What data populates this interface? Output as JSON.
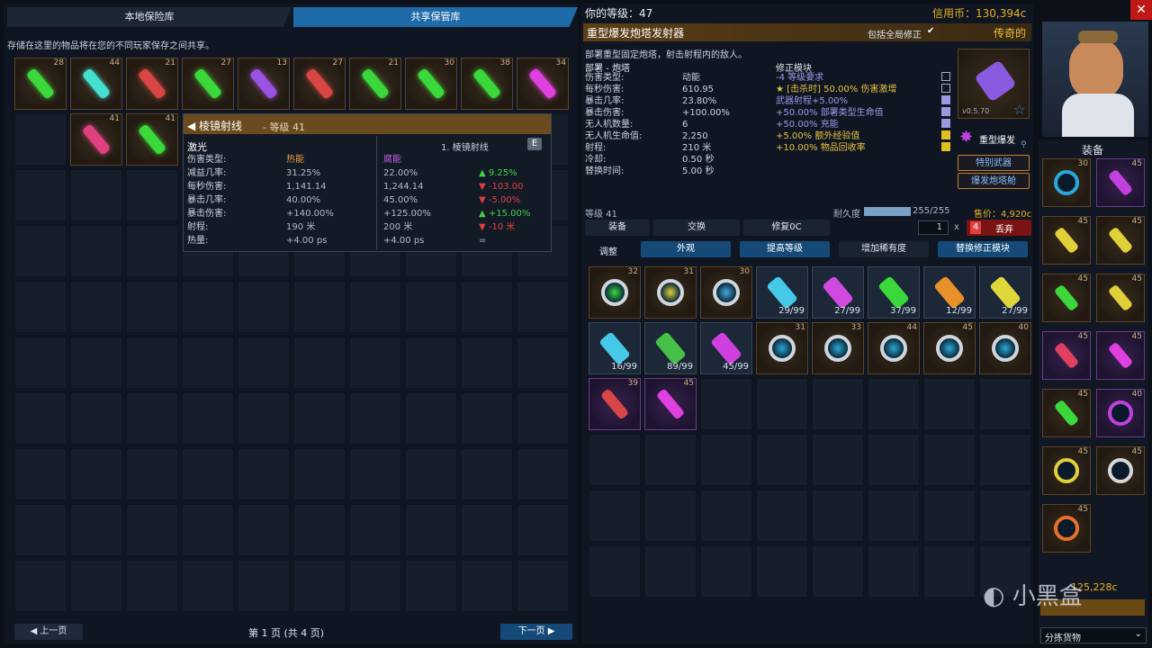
{
  "tabs": {
    "local": "本地保险库",
    "shared": "共享保管库"
  },
  "vault": {
    "description": "存储在这里的物品将在您的不同玩家保存之间共享。",
    "items_row1": [
      {
        "level": "28",
        "color": "#3ad83a"
      },
      {
        "level": "44",
        "color": "#46e0d0"
      },
      {
        "level": "21",
        "color": "#d84646"
      },
      {
        "level": "27",
        "color": "#3ad83a"
      },
      {
        "level": "13",
        "color": "#9a52e0"
      },
      {
        "level": "27",
        "color": "#d84646"
      },
      {
        "level": "21",
        "color": "#3ad83a"
      },
      {
        "level": "30",
        "color": "#3ad83a"
      },
      {
        "level": "38",
        "color": "#3ad83a"
      },
      {
        "level": "34",
        "color": "#e040e0"
      }
    ],
    "items_row2": [
      {
        "level": "41",
        "color": "#e04080"
      },
      {
        "level": "41",
        "color": "#3ad83a"
      }
    ],
    "page_label": "第 1 页 (共 4 页)",
    "prev_label": "◀ 上一页",
    "next_label": "下一页 ▶"
  },
  "tooltip": {
    "title": "◀ 棱镜射线",
    "level": "- 等级 41",
    "name": "激光",
    "compare_name": "1. 棱镜射线",
    "key": "E",
    "col_head_a": "热能",
    "col_head_b": "腐能",
    "rows": [
      {
        "label": "伤害类型:",
        "a": "热能",
        "b": "腐能",
        "d": ""
      },
      {
        "label": "减益几率:",
        "a": "31.25%",
        "b": "22.00%",
        "d": "▲ 9.25%"
      },
      {
        "label": "每秒伤害:",
        "a": "1,141.14",
        "b": "1,244.14",
        "d": "▼ -103.00"
      },
      {
        "label": "暴击几率:",
        "a": "40.00%",
        "b": "45.00%",
        "d": "▼ -5.00%"
      },
      {
        "label": "暴击伤害:",
        "a": "+140.00%",
        "b": "+125.00%",
        "d": "▲ +15.00%"
      },
      {
        "label": "射程:",
        "a": "190 米",
        "b": "200 米",
        "d": "▼ -10 米"
      },
      {
        "label": "热量:",
        "a": "+4.00 ps",
        "b": "+4.00 ps",
        "d": "="
      }
    ]
  },
  "header": {
    "player_level": "你的等级：47",
    "credits": "信用币：130,394c"
  },
  "item": {
    "name": "重型爆发炮塔发射器",
    "include_global": "包括全局修正",
    "rarity": "传奇的",
    "desc": "部署重型固定炮塔，射击射程内的敌人。",
    "section_a": "部署 - 炮塔",
    "section_b": "修正模块",
    "stats": [
      {
        "label": "伤害类型:",
        "value": "动能",
        "mod": "-4 等级要求"
      },
      {
        "label": "每秒伤害:",
        "value": "610.95",
        "mod": "★ [击杀时] 50.00% 伤害激增"
      },
      {
        "label": "暴击几率:",
        "value": "23.80%",
        "mod": "武器射程+5.00%"
      },
      {
        "label": "暴击伤害:",
        "value": "+100.00%",
        "mod": "+50.00% 部署类型生命值"
      },
      {
        "label": "无人机数量:",
        "value": "6",
        "mod": "+50.00% 充能"
      },
      {
        "label": "无人机生命值:",
        "value": "2,250",
        "mod": "+5.00% 额外经验值"
      },
      {
        "label": "射程:",
        "value": "210 米",
        "mod": "+10.00% 物品回收率"
      },
      {
        "label": "冷却:",
        "value": "0.50 秒",
        "mod": ""
      },
      {
        "label": "替换时间:",
        "value": "5.00 秒",
        "mod": ""
      }
    ],
    "version": "v0.5.70",
    "mod_name": "重型爆发",
    "tag1": "特别武器",
    "tag2": "爆发炮塔舱",
    "level": "等级 41",
    "durability_label": "耐久度",
    "durability_value": "255/255",
    "durability_fraction": 1.0,
    "sell": "售价：4,920c"
  },
  "actions": {
    "equip": "装备",
    "swap": "交换",
    "repair": "修复0C",
    "qty": "1",
    "x": "x",
    "drop_key": "4",
    "drop": "丢弃",
    "adjust": "调整",
    "look": "外观",
    "upgrade": "提高等级",
    "rarity": "增加稀有度",
    "replace_mod": "替换修正模块"
  },
  "inventory": [
    {
      "label": "32",
      "kind": "circle",
      "color": "#3ad83a"
    },
    {
      "label": "31",
      "kind": "circle",
      "color": "#e0d03a"
    },
    {
      "label": "30",
      "kind": "circle",
      "color": "#46a8e0"
    },
    {
      "label": "29/99",
      "kind": "pill",
      "color": "#46c8e8"
    },
    {
      "label": "27/99",
      "kind": "pill",
      "color": "#d04ae0"
    },
    {
      "label": "37/99",
      "kind": "pill",
      "color": "#3ad83a"
    },
    {
      "label": "12/99",
      "kind": "pill",
      "color": "#e8902a"
    },
    {
      "label": "27/99",
      "kind": "pill",
      "color": "#e0d83a"
    },
    {
      "label": "16/99",
      "kind": "pill",
      "color": "#46c8e8"
    },
    {
      "label": "89/99",
      "kind": "pill",
      "color": "#46c046"
    },
    {
      "label": "45/99",
      "kind": "pill",
      "color": "#d040e0"
    },
    {
      "label": "31",
      "kind": "circle",
      "color": "#2aa8d8"
    },
    {
      "label": "33",
      "kind": "circle",
      "color": "#2aa8d8"
    },
    {
      "label": "44",
      "kind": "circle",
      "color": "#2aa8d8"
    },
    {
      "label": "45",
      "kind": "circle",
      "color": "#2aa8d8"
    },
    {
      "label": "40",
      "kind": "circle",
      "color": "#2aa8d8"
    },
    {
      "label": "39",
      "kind": "purple",
      "color": "#d84646"
    },
    {
      "label": "45",
      "kind": "purple",
      "color": "#e040e0"
    }
  ],
  "equipment": {
    "title": "装备",
    "slots": [
      {
        "level": "30",
        "color": "#2aa8d8"
      },
      {
        "level": "45",
        "color": "#c040e0"
      },
      {
        "level": "45",
        "color": "#e0d03a"
      },
      {
        "level": "45",
        "color": "#e0d03a"
      },
      {
        "level": "45",
        "color": "#3ad83a"
      },
      {
        "level": "45",
        "color": "#e0d03a"
      },
      {
        "level": "45",
        "color": "#e04060"
      },
      {
        "level": "45",
        "color": "#e040e0"
      },
      {
        "level": "45",
        "color": "#3ad83a"
      },
      {
        "level": "40",
        "color": "#c040e0"
      },
      {
        "level": "45",
        "color": "#e0d03a"
      },
      {
        "level": "45",
        "color": "#d8d8d8"
      },
      {
        "level": "45",
        "color": "#e8702a"
      }
    ],
    "credits": "125,228c",
    "sort_label": "分拣货物"
  },
  "watermark": "小黑盒"
}
